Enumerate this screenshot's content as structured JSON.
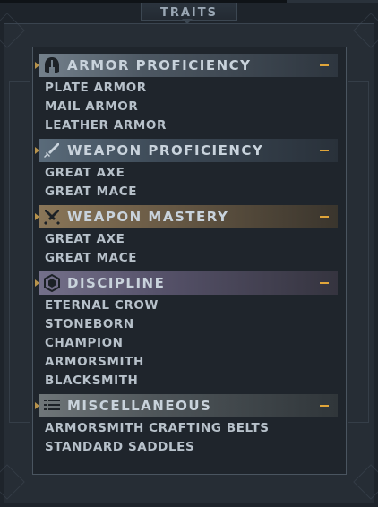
{
  "window": {
    "tab_title": "TRAITS"
  },
  "sections": [
    {
      "title": "ARMOR PROFICIENCY",
      "icon": "helmet-icon",
      "collapse_symbol": "−",
      "items": [
        "PLATE ARMOR",
        "MAIL ARMOR",
        "LEATHER ARMOR"
      ]
    },
    {
      "title": "WEAPON PROFICIENCY",
      "icon": "sword-icon",
      "collapse_symbol": "−",
      "items": [
        "GREAT AXE",
        "GREAT MACE"
      ]
    },
    {
      "title": "WEAPON MASTERY",
      "icon": "crossed-swords-icon",
      "collapse_symbol": "−",
      "items": [
        "GREAT AXE",
        "GREAT MACE"
      ]
    },
    {
      "title": "DISCIPLINE",
      "icon": "hexagon-icon",
      "collapse_symbol": "−",
      "items": [
        "ETERNAL CROW",
        "STONEBORN",
        "CHAMPION",
        "ARMORSMITH",
        "BLACKSMITH"
      ]
    },
    {
      "title": "MISCELLANEOUS",
      "icon": "list-icon",
      "collapse_symbol": "−",
      "items": [
        "ARMORSMITH CRAFTING BELTS",
        "STANDARD SADDLES"
      ]
    }
  ],
  "colors": {
    "accent": "#e0a53a",
    "text": "#b7c1ca",
    "header_text": "#c9d3dc",
    "background": "#1f252c"
  }
}
